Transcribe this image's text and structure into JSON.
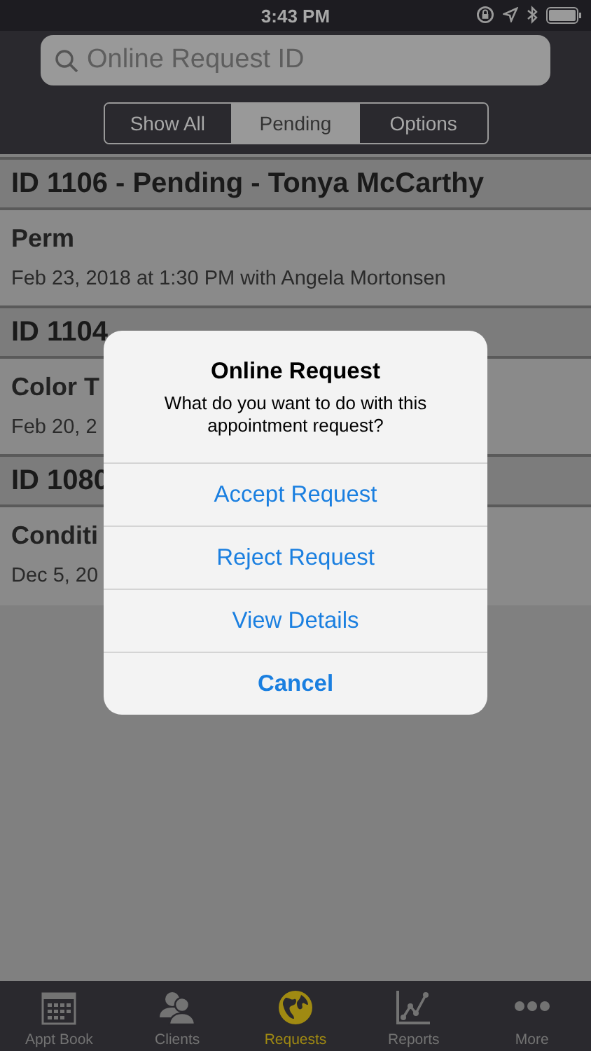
{
  "status_bar": {
    "time": "3:43 PM"
  },
  "search": {
    "placeholder": "Online Request ID"
  },
  "segments": [
    {
      "label": "Show All",
      "selected": false
    },
    {
      "label": "Pending",
      "selected": true
    },
    {
      "label": "Options",
      "selected": false
    }
  ],
  "requests": [
    {
      "header": "ID 1106 - Pending - Tonya McCarthy",
      "service": "Perm",
      "detail": "Feb 23, 2018 at 1:30 PM with Angela Mortonsen"
    },
    {
      "header": "ID 1104",
      "service": "Color T",
      "detail": "Feb 20, 2"
    },
    {
      "header": "ID 1080",
      "service": "Conditi",
      "detail": "Dec 5, 20"
    }
  ],
  "alert": {
    "title": "Online Request",
    "message": "What do you want to do with this appointment request?",
    "actions": [
      {
        "label": "Accept Request",
        "kind": "default"
      },
      {
        "label": "Reject Request",
        "kind": "default"
      },
      {
        "label": "View Details",
        "kind": "default"
      },
      {
        "label": "Cancel",
        "kind": "cancel"
      }
    ]
  },
  "tab_bar": [
    {
      "label": "Appt Book",
      "kind": "calendar",
      "selected": false
    },
    {
      "label": "Clients",
      "kind": "people",
      "selected": false
    },
    {
      "label": "Requests",
      "kind": "globe",
      "selected": true
    },
    {
      "label": "Reports",
      "kind": "chart",
      "selected": false
    },
    {
      "label": "More",
      "kind": "dots",
      "selected": false
    }
  ]
}
